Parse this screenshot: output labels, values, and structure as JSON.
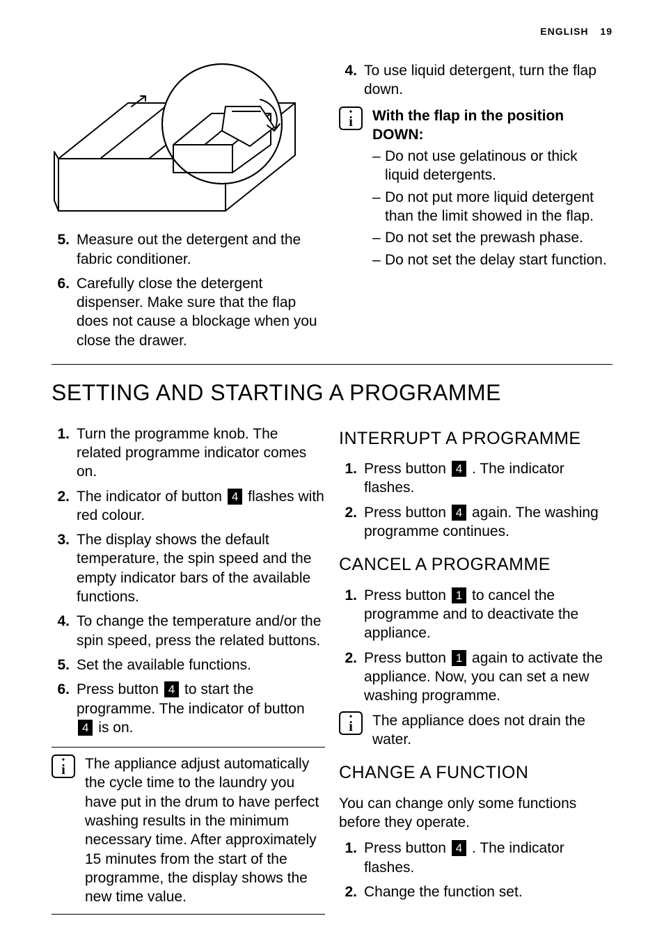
{
  "header": {
    "language": "ENGLISH",
    "page_number": "19"
  },
  "top": {
    "left_steps": [
      {
        "n": "5.",
        "text": "Measure out the detergent and the fabric conditioner."
      },
      {
        "n": "6.",
        "text": "Carefully close the detergent dispenser. Make sure that the flap does not cause a blockage when you close the drawer."
      }
    ],
    "right": {
      "step4": {
        "n": "4.",
        "text": "To use liquid detergent, turn the flap down."
      },
      "info_heading": "With the flap in the position DOWN:",
      "info_items": [
        "Do not use gelatinous or thick liquid detergents.",
        "Do not put more liquid detergent than the limit showed in the flap.",
        "Do not set the prewash phase.",
        "Do not set the delay start function."
      ]
    }
  },
  "section1": {
    "title": "SETTING AND STARTING A PROGRAMME",
    "left": {
      "steps": [
        {
          "n": "1.",
          "text": "Turn the programme knob. The related programme indicator comes on."
        },
        {
          "n": "2.",
          "pre": "The indicator of button ",
          "chip": "4",
          "post": " flashes with red colour."
        },
        {
          "n": "3.",
          "text": "The display shows the default temperature, the spin speed and the empty indicator bars of the available functions."
        },
        {
          "n": "4.",
          "text": "To change the temperature and/or the spin speed, press the related buttons."
        },
        {
          "n": "5.",
          "text": "Set the available functions."
        },
        {
          "n": "6.",
          "pre": "Press button ",
          "chip1": "4",
          "mid": " to start the programme. The indicator of button ",
          "chip2": "4",
          "post": " is on."
        }
      ],
      "note": "The appliance adjust automatically the cycle time to the laundry you have put in the drum to have perfect washing results in the minimum necessary time. After approximately 15 minutes from the start of the programme, the display shows the new time value."
    },
    "right": {
      "interrupt": {
        "title": "INTERRUPT A PROGRAMME",
        "steps": [
          {
            "n": "1.",
            "pre": "Press button ",
            "chip": "4",
            "post": " . The indicator flashes."
          },
          {
            "n": "2.",
            "pre": "Press button ",
            "chip": "4",
            "post": " again. The washing programme continues."
          }
        ]
      },
      "cancel": {
        "title": "CANCEL A PROGRAMME",
        "steps": [
          {
            "n": "1.",
            "pre": "Press button ",
            "chip": "1",
            "post": " to cancel the programme and to deactivate the appliance."
          },
          {
            "n": "2.",
            "pre": "Press button ",
            "chip": "1",
            "post": " again to activate the appliance. Now, you can set a new washing programme."
          }
        ],
        "note": "The appliance does not drain the water."
      },
      "change": {
        "title": "CHANGE A FUNCTION",
        "intro": "You can change only some functions before they operate.",
        "steps": [
          {
            "n": "1.",
            "pre": "Press button ",
            "chip": "4",
            "post": " . The indicator flashes."
          },
          {
            "n": "2.",
            "text": "Change the function set."
          }
        ]
      }
    }
  }
}
